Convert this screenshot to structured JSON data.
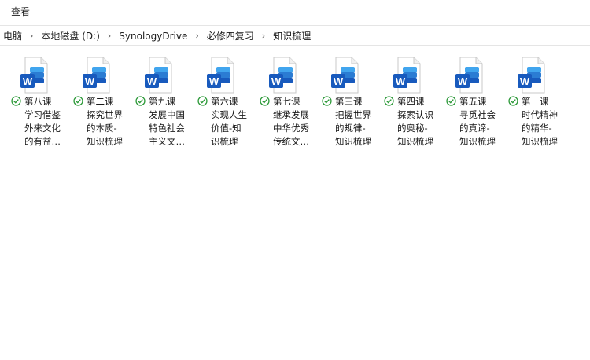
{
  "menubar": {
    "view_label": "查看"
  },
  "breadcrumb": [
    "电脑",
    "本地磁盘 (D:)",
    "SynologyDrive",
    "必修四复习",
    "知识梳理"
  ],
  "files": [
    {
      "lines": [
        "第八课",
        "学习借鉴",
        "外来文化",
        "的有益…"
      ]
    },
    {
      "lines": [
        "第二课",
        "探究世界",
        "的本质-",
        "知识梳理"
      ]
    },
    {
      "lines": [
        "第九课",
        "发展中国",
        "特色社会",
        "主义文…"
      ]
    },
    {
      "lines": [
        "第六课",
        "实现人生",
        "价值-知",
        "识梳理"
      ]
    },
    {
      "lines": [
        "第七课",
        "继承发展",
        "中华优秀",
        "传统文…"
      ]
    },
    {
      "lines": [
        "第三课",
        "把握世界",
        "的规律-",
        "知识梳理"
      ]
    },
    {
      "lines": [
        "第四课",
        "探索认识",
        "的奥秘-",
        "知识梳理"
      ]
    },
    {
      "lines": [
        "第五课",
        "寻觅社会",
        "的真谛-",
        "知识梳理"
      ]
    },
    {
      "lines": [
        "第一课",
        "时代精神",
        "的精华-",
        "知识梳理"
      ]
    }
  ],
  "icons": {
    "file": "word-document-icon",
    "status": "synced-check-icon",
    "separator": "chevron-right-icon"
  },
  "colors": {
    "word_blue": "#185abd",
    "sync_green": "#2e9a3a"
  }
}
